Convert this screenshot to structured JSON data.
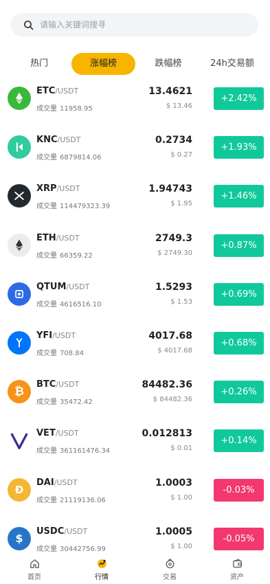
{
  "search": {
    "placeholder": "请输入关键词搜寻"
  },
  "tabs": [
    {
      "label": "热门"
    },
    {
      "label": "涨幅榜",
      "active": true
    },
    {
      "label": "跌幅榜"
    },
    {
      "label": "24h交易额"
    }
  ],
  "volume_label": "成交量",
  "up_color": "#10c99a",
  "down_color": "#f2386e",
  "accent_color": "#f7b500",
  "coins": [
    {
      "symbol": "ETC",
      "quote": "/USDT",
      "volume": "11958.95",
      "price": "13.4621",
      "usd": "$ 13.46",
      "change": "+2.42%",
      "dir": "up",
      "icon": "etc-icon",
      "icon_color": "#3ab83a"
    },
    {
      "symbol": "KNC",
      "quote": "/USDT",
      "volume": "6879814.06",
      "price": "0.2734",
      "usd": "$ 0.27",
      "change": "+1.93%",
      "dir": "up",
      "icon": "knc-icon",
      "icon_color": "#31cb9e"
    },
    {
      "symbol": "XRP",
      "quote": "/USDT",
      "volume": "114479323.39",
      "price": "1.94743",
      "usd": "$ 1.95",
      "change": "+1.46%",
      "dir": "up",
      "icon": "xrp-icon",
      "icon_color": "#23292f"
    },
    {
      "symbol": "ETH",
      "quote": "/USDT",
      "volume": "66359.22",
      "price": "2749.3",
      "usd": "$ 2749.30",
      "change": "+0.87%",
      "dir": "up",
      "icon": "eth-icon",
      "icon_color": "#ececec"
    },
    {
      "symbol": "QTUM",
      "quote": "/USDT",
      "volume": "4616516.10",
      "price": "1.5293",
      "usd": "$ 1.53",
      "change": "+0.69%",
      "dir": "up",
      "icon": "qtum-icon",
      "icon_color": "#2e6ae6"
    },
    {
      "symbol": "YFI",
      "quote": "/USDT",
      "volume": "708.84",
      "price": "4017.68",
      "usd": "$ 4017.68",
      "change": "+0.68%",
      "dir": "up",
      "icon": "yfi-icon",
      "icon_color": "#0074fa"
    },
    {
      "symbol": "BTC",
      "quote": "/USDT",
      "volume": "35472.42",
      "price": "84482.36",
      "usd": "$ 84482.36",
      "change": "+0.26%",
      "dir": "up",
      "icon": "btc-icon",
      "icon_color": "#f7931a"
    },
    {
      "symbol": "VET",
      "quote": "/USDT",
      "volume": "361161476.34",
      "price": "0.012813",
      "usd": "$ 0.01",
      "change": "+0.14%",
      "dir": "up",
      "icon": "vet-icon",
      "icon_color": "#ffffff"
    },
    {
      "symbol": "DAI",
      "quote": "/USDT",
      "volume": "21119136.06",
      "price": "1.0003",
      "usd": "$ 1.00",
      "change": "-0.03%",
      "dir": "down",
      "icon": "dai-icon",
      "icon_color": "#f4b731"
    },
    {
      "symbol": "USDC",
      "quote": "/USDT",
      "volume": "30442756.99",
      "price": "1.0005",
      "usd": "$ 1.00",
      "change": "-0.05%",
      "dir": "down",
      "icon": "usdc-icon",
      "icon_color": "#2775ca"
    }
  ],
  "tabbar": [
    {
      "label": "首页",
      "icon": "home-icon"
    },
    {
      "label": "行情",
      "icon": "market-icon",
      "active": true
    },
    {
      "label": "交易",
      "icon": "trade-icon"
    },
    {
      "label": "资产",
      "icon": "wallet-icon"
    }
  ]
}
